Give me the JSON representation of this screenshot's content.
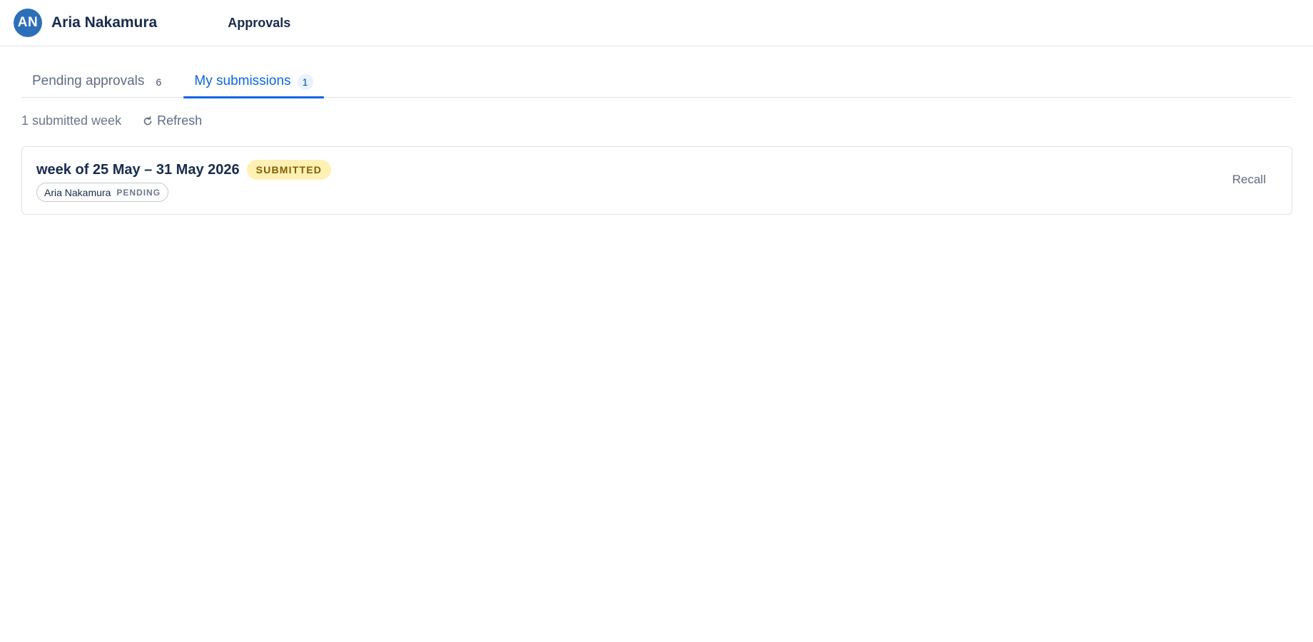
{
  "header": {
    "avatar_initials": "AN",
    "user_name": "Aria Nakamura",
    "nav_item": "Approvals"
  },
  "tabs": [
    {
      "label": "Pending approvals",
      "count": "6",
      "active": false
    },
    {
      "label": "My submissions",
      "count": "1",
      "active": true
    }
  ],
  "toolbar": {
    "summary": "1 submitted week",
    "refresh_label": "Refresh",
    "refresh_icon": "refresh-icon"
  },
  "submissions": [
    {
      "title": "week of 25 May – 31 May 2026",
      "status": "SUBMITTED",
      "approver_name": "Aria Nakamura",
      "approver_status": "PENDING",
      "action_label": "Recall"
    }
  ],
  "colors": {
    "accent": "#0c66e4",
    "avatar_bg": "#2c6fb9",
    "submitted_badge_bg": "#fff0b3",
    "submitted_badge_text": "#7f5f01"
  }
}
